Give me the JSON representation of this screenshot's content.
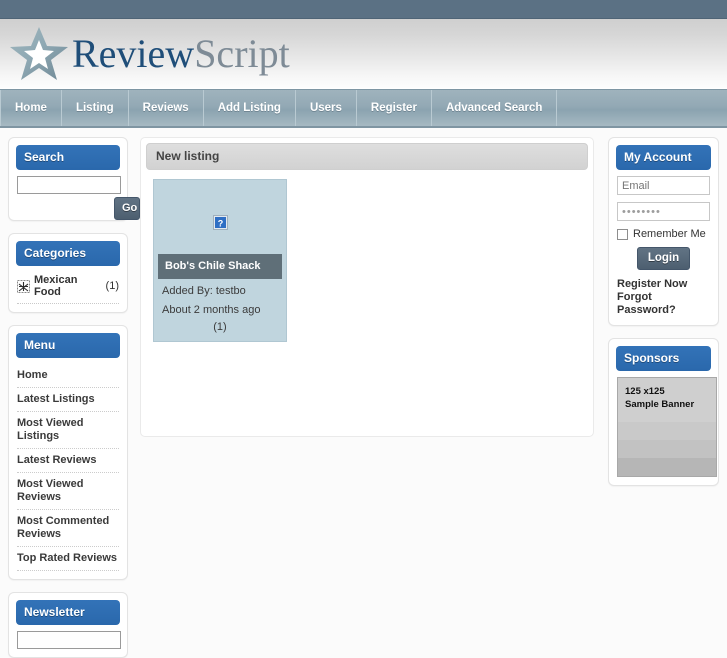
{
  "site": {
    "logo_primary": "Review",
    "logo_secondary": "Script",
    "logo_icon": "star-icon"
  },
  "nav": {
    "items": [
      {
        "label": "Home",
        "name": "nav-home"
      },
      {
        "label": "Listing",
        "name": "nav-listing"
      },
      {
        "label": "Reviews",
        "name": "nav-reviews"
      },
      {
        "label": "Add Listing",
        "name": "nav-add-listing"
      },
      {
        "label": "Users",
        "name": "nav-users"
      },
      {
        "label": "Register",
        "name": "nav-register"
      },
      {
        "label": "Advanced Search",
        "name": "nav-advanced-search"
      }
    ]
  },
  "sidebar_left": {
    "search": {
      "title": "Search",
      "value": "",
      "placeholder": "",
      "button_label": "Go"
    },
    "categories": {
      "title": "Categories",
      "items": [
        {
          "label": "Mexican Food",
          "count": "(1)",
          "icon": "broken-image-icon"
        }
      ]
    },
    "menu": {
      "title": "Menu",
      "items": [
        "Home",
        "Latest Listings",
        "Most Viewed Listings",
        "Latest Reviews",
        "Most Viewed Reviews",
        "Most Commented Reviews",
        "Top Rated Reviews"
      ]
    },
    "newsletter": {
      "title": "Newsletter",
      "value": "",
      "placeholder": ""
    }
  },
  "main": {
    "panel_title": "New listing",
    "listings": [
      {
        "title": "Bob's Chile Shack",
        "added_by": "Added By: testbo",
        "age": "About 2 months ago",
        "rating": "(1)",
        "thumb_icon": "broken-image-icon"
      }
    ]
  },
  "sidebar_right": {
    "account": {
      "title": "My Account",
      "email_value": "",
      "email_placeholder": "Email",
      "password_value": "••••••••",
      "password_placeholder": "",
      "remember_label": "Remember Me",
      "login_label": "Login",
      "register_link": "Register Now",
      "forgot_link": "Forgot Password?"
    },
    "sponsors": {
      "title": "Sponsors",
      "banner_line1": "125 x125",
      "banner_line2": "Sample Banner"
    }
  },
  "colors": {
    "topbar": "#5b7184",
    "nav": "#93a9b5",
    "widget_header": "#2b6cb0",
    "listing_card": "#c0d5de",
    "listing_title_bar": "#5f6f78",
    "button": "#57697b",
    "logo_primary": "#1f4e79",
    "logo_secondary": "#7e8b96"
  }
}
